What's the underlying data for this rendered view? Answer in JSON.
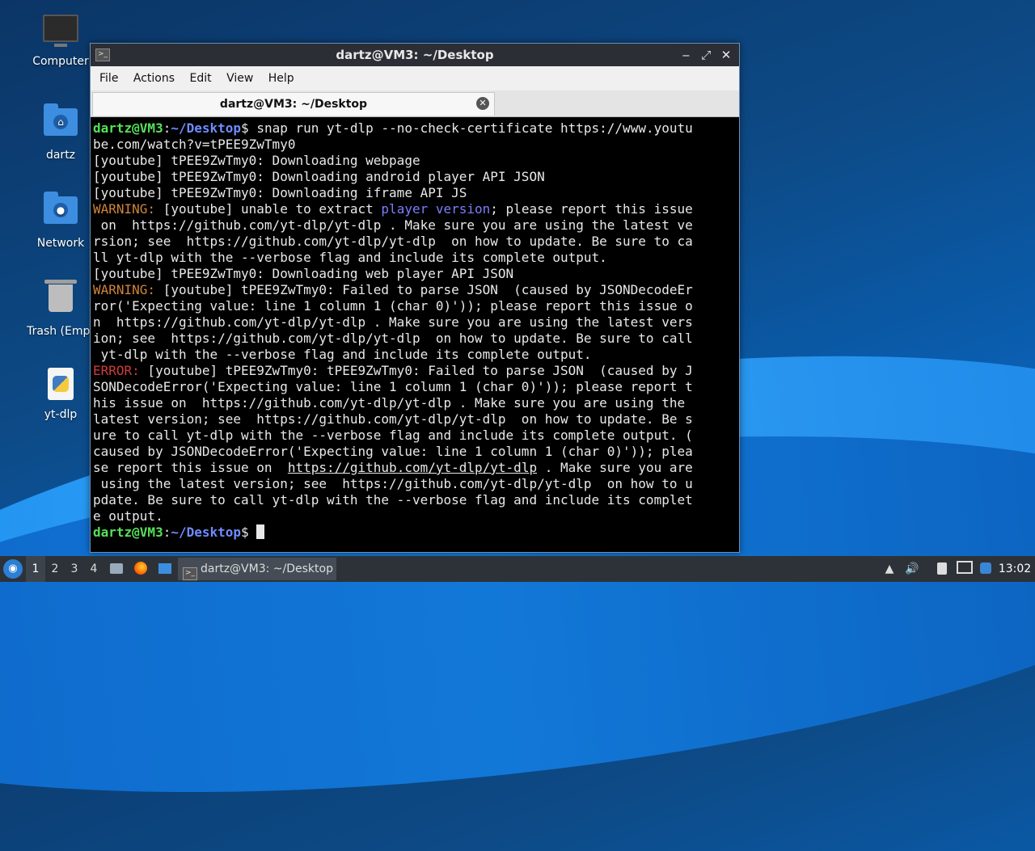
{
  "desktop": {
    "icons": [
      {
        "label": "Computer",
        "icon": "computer-icon"
      },
      {
        "label": "dartz",
        "icon": "home-folder-icon"
      },
      {
        "label": "Network",
        "icon": "network-folder-icon"
      },
      {
        "label": "Trash (Empt",
        "icon": "trash-icon"
      },
      {
        "label": "yt-dlp",
        "icon": "python-file-icon"
      }
    ]
  },
  "window": {
    "title": "dartz@VM3: ~/Desktop",
    "controls": {
      "minimize": "‒",
      "maximize": "⤢",
      "close": "✕"
    },
    "menu": [
      "File",
      "Actions",
      "Edit",
      "View",
      "Help"
    ],
    "tab_label": "dartz@VM3: ~/Desktop"
  },
  "terminal": {
    "prompt_user": "dartz@VM3",
    "prompt_sep": ":",
    "prompt_path": "~/Desktop",
    "prompt_symbol": "$ ",
    "command_line1": "snap run yt-dlp --no-check-certificate https://www.youtu",
    "command_line2": "be.com/watch?v=tPEE9ZwTmy0",
    "l1": "[youtube] tPEE9ZwTmy0: Downloading webpage",
    "l2": "[youtube] tPEE9ZwTmy0: Downloading android player API JSON",
    "l3": "[youtube] tPEE9ZwTmy0: Downloading iframe API JS",
    "w1_tag": "WARNING:",
    "w1_a": " [youtube] unable to extract ",
    "w1_hl": "player version",
    "w1_b": "; please report this issue",
    "w1_c": " on  https://github.com/yt-dlp/yt-dlp . Make sure you are using the latest ve",
    "w1_d": "rsion; see  https://github.com/yt-dlp/yt-dlp  on how to update. Be sure to ca",
    "w1_e": "ll yt-dlp with the --verbose flag and include its complete output.",
    "l4": "[youtube] tPEE9ZwTmy0: Downloading web player API JSON",
    "w2_tag": "WARNING:",
    "w2_a": " [youtube] tPEE9ZwTmy0: Failed to parse JSON  (caused by JSONDecodeEr",
    "w2_b": "ror('Expecting value: line 1 column 1 (char 0)')); please report this issue o",
    "w2_c": "n  https://github.com/yt-dlp/yt-dlp . Make sure you are using the latest vers",
    "w2_d": "ion; see  https://github.com/yt-dlp/yt-dlp  on how to update. Be sure to call",
    "w2_e": " yt-dlp with the --verbose flag and include its complete output.",
    "e_tag": "ERROR:",
    "e_a": " [youtube] tPEE9ZwTmy0: tPEE9ZwTmy0: Failed to parse JSON  (caused by J",
    "e_b": "SONDecodeError('Expecting value: line 1 column 1 (char 0)')); please report t",
    "e_c": "his issue on  https://github.com/yt-dlp/yt-dlp . Make sure you are using the",
    "e_d": "latest version; see  https://github.com/yt-dlp/yt-dlp  on how to update. Be s",
    "e_e": "ure to call yt-dlp with the --verbose flag and include its complete output. (",
    "e_f": "caused by JSONDecodeError('Expecting value: line 1 column 1 (char 0)')); plea",
    "e_g1": "se report this issue on  ",
    "e_g_link": "https://github.com/yt-dlp/yt-dlp",
    "e_g2": " . Make sure you are",
    "e_h": " using the latest version; see  https://github.com/yt-dlp/yt-dlp  on how to u",
    "e_i": "pdate. Be sure to call yt-dlp with the --verbose flag and include its complet",
    "e_j": "e output."
  },
  "taskbar": {
    "workspaces": [
      "1",
      "2",
      "3",
      "4"
    ],
    "active_workspace": "1",
    "app_label": "dartz@VM3: ~/Desktop",
    "clock": "13:02"
  },
  "colors": {
    "prompt_user": "#56e05a",
    "prompt_path": "#6f8cff",
    "warning": "#d0843a",
    "error": "#d23b3b"
  }
}
